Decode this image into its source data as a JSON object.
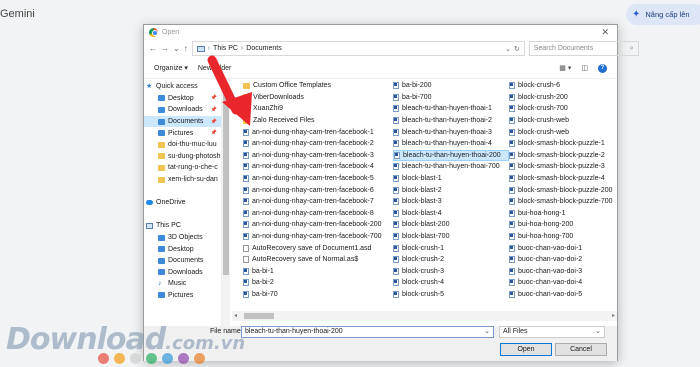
{
  "app_title": "Gemini",
  "upgrade_label": "Nâng cấp lên",
  "dialog": {
    "title": "Open",
    "address": {
      "part1": "This PC",
      "part2": "Documents"
    },
    "search_placeholder": "Search Documents",
    "organize_label": "Organize ▾",
    "new_folder_label": "New folder",
    "nav_items": [
      {
        "label": "Quick access",
        "icon": "star-icon",
        "pin": false,
        "sel": false,
        "indent": 2
      },
      {
        "label": "Desktop",
        "icon": "blue",
        "pin": true,
        "sel": false,
        "indent": 14
      },
      {
        "label": "Downloads",
        "icon": "blue",
        "pin": true,
        "sel": false,
        "indent": 14
      },
      {
        "label": "Documents",
        "icon": "blue",
        "pin": true,
        "sel": true,
        "indent": 14
      },
      {
        "label": "Pictures",
        "icon": "blue",
        "pin": true,
        "sel": false,
        "indent": 14
      },
      {
        "label": "doi-thu-muc-luu",
        "icon": "folder",
        "pin": false,
        "sel": false,
        "indent": 14
      },
      {
        "label": "su-dung-photosh",
        "icon": "folder",
        "pin": false,
        "sel": false,
        "indent": 14
      },
      {
        "label": "tat-rung-o-che-c",
        "icon": "folder",
        "pin": false,
        "sel": false,
        "indent": 14
      },
      {
        "label": "xem-lich-su-dan",
        "icon": "folder",
        "pin": false,
        "sel": false,
        "indent": 14
      },
      {
        "label": "",
        "icon": "none",
        "pin": false,
        "sel": false,
        "indent": 2
      },
      {
        "label": "OneDrive",
        "icon": "cloud",
        "pin": false,
        "sel": false,
        "indent": 2
      },
      {
        "label": "",
        "icon": "none",
        "pin": false,
        "sel": false,
        "indent": 2
      },
      {
        "label": "This PC",
        "icon": "pc",
        "pin": false,
        "sel": false,
        "indent": 2
      },
      {
        "label": "3D Objects",
        "icon": "blue",
        "pin": false,
        "sel": false,
        "indent": 14
      },
      {
        "label": "Desktop",
        "icon": "blue",
        "pin": false,
        "sel": false,
        "indent": 14
      },
      {
        "label": "Documents",
        "icon": "blue",
        "pin": false,
        "sel": false,
        "indent": 14
      },
      {
        "label": "Downloads",
        "icon": "blue",
        "pin": false,
        "sel": false,
        "indent": 14
      },
      {
        "label": "Music",
        "icon": "music",
        "pin": false,
        "sel": false,
        "indent": 14
      },
      {
        "label": "Pictures",
        "icon": "blue",
        "pin": false,
        "sel": false,
        "indent": 14
      }
    ],
    "files": [
      [
        {
          "name": "Custom Office Templates",
          "type": "folder"
        },
        {
          "name": "ViberDownloads",
          "type": "folder"
        },
        {
          "name": "XuanZhi9",
          "type": "folder"
        },
        {
          "name": "Zalo Received Files",
          "type": "folder"
        },
        {
          "name": "an-noi-dung-nhay-cam-tren-facebook-1",
          "type": "word"
        },
        {
          "name": "an-noi-dung-nhay-cam-tren-facebook-2",
          "type": "word"
        },
        {
          "name": "an-noi-dung-nhay-cam-tren-facebook-3",
          "type": "word"
        },
        {
          "name": "an-noi-dung-nhay-cam-tren-facebook-4",
          "type": "word"
        },
        {
          "name": "an-noi-dung-nhay-cam-tren-facebook-5",
          "type": "word"
        },
        {
          "name": "an-noi-dung-nhay-cam-tren-facebook-6",
          "type": "word"
        },
        {
          "name": "an-noi-dung-nhay-cam-tren-facebook-7",
          "type": "word"
        },
        {
          "name": "an-noi-dung-nhay-cam-tren-facebook-8",
          "type": "word"
        },
        {
          "name": "an-noi-dung-nhay-cam-tren-facebook-200",
          "type": "word"
        },
        {
          "name": "an-noi-dung-nhay-cam-tren-facebook-700",
          "type": "word"
        },
        {
          "name": "AutoRecovery save of Document1.asd",
          "type": "doc"
        },
        {
          "name": "AutoRecovery save of Normal.as$",
          "type": "doc"
        },
        {
          "name": "ba-bi-1",
          "type": "word"
        },
        {
          "name": "ba-bi-2",
          "type": "word"
        },
        {
          "name": "ba-bi-70",
          "type": "word"
        }
      ],
      [
        {
          "name": "ba-bi-200",
          "type": "word"
        },
        {
          "name": "ba-bi-700",
          "type": "word"
        },
        {
          "name": "bleach-tu-than-huyen-thoai-1",
          "type": "word"
        },
        {
          "name": "bleach-tu-than-huyen-thoai-2",
          "type": "word"
        },
        {
          "name": "bleach-tu-than-huyen-thoai-3",
          "type": "word"
        },
        {
          "name": "bleach-tu-than-huyen-thoai-4",
          "type": "word"
        },
        {
          "name": "bleach-tu-than-huyen-thoai-200",
          "type": "word",
          "sel": true
        },
        {
          "name": "bleach-tu-than-huyen-thoai-700",
          "type": "word"
        },
        {
          "name": "block-blast-1",
          "type": "word"
        },
        {
          "name": "block-blast-2",
          "type": "word"
        },
        {
          "name": "block-blast-3",
          "type": "word"
        },
        {
          "name": "block-blast-4",
          "type": "word"
        },
        {
          "name": "block-blast-200",
          "type": "word"
        },
        {
          "name": "block-blast-700",
          "type": "word"
        },
        {
          "name": "block-crush-1",
          "type": "word"
        },
        {
          "name": "block-crush-2",
          "type": "word"
        },
        {
          "name": "block-crush-3",
          "type": "word"
        },
        {
          "name": "block-crush-4",
          "type": "word"
        },
        {
          "name": "block-crush-5",
          "type": "word"
        }
      ],
      [
        {
          "name": "block-crush-6",
          "type": "word"
        },
        {
          "name": "block-crush-200",
          "type": "word"
        },
        {
          "name": "block-crush-700",
          "type": "word"
        },
        {
          "name": "block-crush-web",
          "type": "word"
        },
        {
          "name": "block-crush-web",
          "type": "word"
        },
        {
          "name": "block-smash-block-puzzle-1",
          "type": "word"
        },
        {
          "name": "block-smash-block-puzzle-2",
          "type": "word"
        },
        {
          "name": "block-smash-block-puzzle-3",
          "type": "word"
        },
        {
          "name": "block-smash-block-puzzle-4",
          "type": "word"
        },
        {
          "name": "block-smash-block-puzzle-200",
          "type": "word"
        },
        {
          "name": "block-smash-block-puzzle-700",
          "type": "word"
        },
        {
          "name": "bui-hoa-hong-1",
          "type": "word"
        },
        {
          "name": "bui-hoa-hong-200",
          "type": "word"
        },
        {
          "name": "bui-hoa-hong-700",
          "type": "word"
        },
        {
          "name": "buoc-chan-vao-doi-1",
          "type": "word"
        },
        {
          "name": "buoc-chan-vao-doi-2",
          "type": "word"
        },
        {
          "name": "buoc-chan-vao-doi-3",
          "type": "word"
        },
        {
          "name": "buoc-chan-vao-doi-4",
          "type": "word"
        },
        {
          "name": "buoc-chan-vao-doi-5",
          "type": "word"
        }
      ]
    ],
    "file_name_label": "File name:",
    "file_name_value": "bleach-tu-than-huyen-thoai-200",
    "filter_value": "All Files",
    "open_label": "Open",
    "cancel_label": "Cancel"
  },
  "watermark": {
    "main": "Download",
    "suffix": ".com.vn"
  },
  "colors": {
    "arrow": "#e8262b",
    "selection": "#cce8ff",
    "dots": [
      "#e74c3c",
      "#f39c12",
      "#cfcfcf",
      "#27ae60",
      "#3498db",
      "#8e44ad",
      "#e67e22"
    ]
  }
}
